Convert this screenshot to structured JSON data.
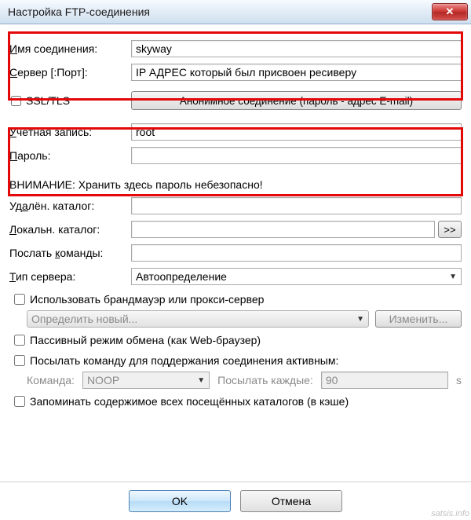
{
  "window": {
    "title": "Настройка FTP-соединения"
  },
  "labels": {
    "connection_name": "Имя соединения:",
    "server_port": "Сервер [:Порт]:",
    "ssl_tls": "SSL/TLS",
    "anon_button": "Анонимное соединение (пароль - адрес E-mail)",
    "account": "Учётная запись:",
    "password": "Пароль:",
    "warning": "ВНИМАНИЕ: Хранить здесь пароль небезопасно!",
    "remote_dir": "Удалён. каталог:",
    "local_dir": "Локальн. каталог:",
    "send_cmds": "Послать команды:",
    "server_type": "Тип сервера:",
    "browse": ">>",
    "use_proxy": "Использовать брандмауэр или прокси-сервер",
    "proxy_define": "Определить новый...",
    "proxy_change": "Изменить...",
    "passive": "Пассивный режим обмена (как Web-браузер)",
    "keepalive": "Посылать команду для поддержания соединения активным:",
    "keepalive_cmd_label": "Команда:",
    "keepalive_every_label": "Посылать каждые:",
    "seconds_suffix": "s",
    "cache_dirs": "Запоминать содержимое всех посещённых каталогов (в кэше)"
  },
  "values": {
    "connection_name": "skyway",
    "server_port": "IP АДРЕС который был присвоен ресиверу",
    "account": "root",
    "password": "",
    "remote_dir": "",
    "local_dir": "",
    "send_cmds": "",
    "server_type_selected": "Автоопределение",
    "keepalive_cmd": "NOOP",
    "keepalive_every": "90"
  },
  "buttons": {
    "ok": "OK",
    "cancel": "Отмена"
  },
  "watermark": "satsis.info"
}
